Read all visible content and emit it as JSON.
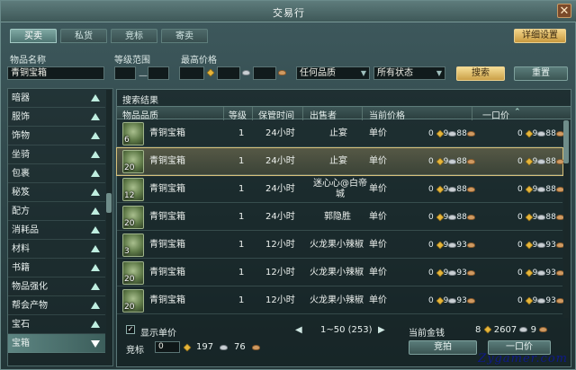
{
  "window": {
    "title": "交易行",
    "close_glyph": "✕"
  },
  "tabs": [
    {
      "label": "买卖",
      "active": true
    },
    {
      "label": "私货",
      "active": false
    },
    {
      "label": "竞标",
      "active": false
    },
    {
      "label": "寄卖",
      "active": false
    }
  ],
  "detail_settings_label": "详细设置",
  "filters": {
    "item_name_label": "物品名称",
    "item_name_value": "青铜宝箱",
    "level_range_label": "等级范围",
    "max_price_label": "最高价格",
    "quality_select": "任何品质",
    "status_select": "所有状态",
    "search_button": "搜索",
    "reset_button": "重置"
  },
  "categories": [
    {
      "label": "暗器"
    },
    {
      "label": "服饰"
    },
    {
      "label": "饰物"
    },
    {
      "label": "坐骑"
    },
    {
      "label": "包裹"
    },
    {
      "label": "秘笈"
    },
    {
      "label": "配方"
    },
    {
      "label": "消耗品"
    },
    {
      "label": "材料"
    },
    {
      "label": "书籍"
    },
    {
      "label": "物品强化"
    },
    {
      "label": "帮会产物"
    },
    {
      "label": "宝石"
    },
    {
      "label": "宝箱",
      "selected": true
    }
  ],
  "results": {
    "title": "搜索结果",
    "columns": [
      "物品品质",
      "等级",
      "保管时间",
      "出售者",
      "当前价格",
      "一口价"
    ],
    "rows": [
      {
        "qty": "6",
        "name": "青铜宝箱",
        "level": "1",
        "time": "24小时",
        "seller": "止宴",
        "price_label": "单价",
        "cur": [
          "0",
          "9",
          "88"
        ],
        "buy": [
          "0",
          "9",
          "88"
        ],
        "selected": false
      },
      {
        "qty": "20",
        "name": "青铜宝箱",
        "level": "1",
        "time": "24小时",
        "seller": "止宴",
        "price_label": "单价",
        "cur": [
          "0",
          "9",
          "88"
        ],
        "buy": [
          "0",
          "9",
          "88"
        ],
        "selected": true
      },
      {
        "qty": "12",
        "name": "青铜宝箱",
        "level": "1",
        "time": "24小时",
        "seller": "迷心心@白帝城",
        "seller_lines": [
          "迷心心@白帝",
          "城"
        ],
        "price_label": "单价",
        "cur": [
          "0",
          "9",
          "88"
        ],
        "buy": [
          "0",
          "9",
          "88"
        ],
        "selected": false
      },
      {
        "qty": "20",
        "name": "青铜宝箱",
        "level": "1",
        "time": "24小时",
        "seller": "郭隐胜",
        "price_label": "单价",
        "cur": [
          "0",
          "9",
          "88"
        ],
        "buy": [
          "0",
          "9",
          "88"
        ],
        "selected": false
      },
      {
        "qty": "3",
        "name": "青铜宝箱",
        "level": "1",
        "time": "12小时",
        "seller": "火龙果小辣椒",
        "price_label": "单价",
        "cur": [
          "0",
          "9",
          "93"
        ],
        "buy": [
          "0",
          "9",
          "93"
        ],
        "selected": false
      },
      {
        "qty": "20",
        "name": "青铜宝箱",
        "level": "1",
        "time": "12小时",
        "seller": "火龙果小辣椒",
        "price_label": "单价",
        "cur": [
          "0",
          "9",
          "93"
        ],
        "buy": [
          "0",
          "9",
          "93"
        ],
        "selected": false
      },
      {
        "qty": "20",
        "name": "青铜宝箱",
        "level": "1",
        "time": "12小时",
        "seller": "火龙果小辣椒",
        "price_label": "单价",
        "cur": [
          "0",
          "9",
          "93"
        ],
        "buy": [
          "0",
          "9",
          "93"
        ],
        "selected": false
      }
    ]
  },
  "footer": {
    "show_unit_price_label": "显示单价",
    "show_unit_price_checked": true,
    "pagination": "1~50 (253)",
    "current_money_label": "当前金钱",
    "money": {
      "gold": "8",
      "silver": "2607",
      "copper": "9"
    },
    "bid_label": "竞标",
    "bid": {
      "gold": "0",
      "silver": "197",
      "copper": "76"
    },
    "bid_button": "竞拍",
    "buyout_button": "一口价"
  },
  "watermark": "Zygamer.com"
}
